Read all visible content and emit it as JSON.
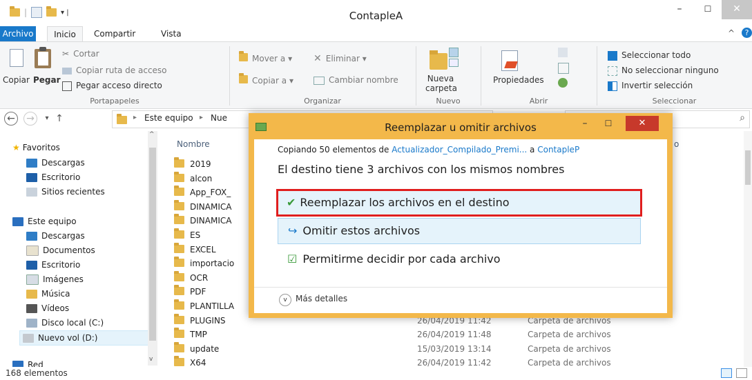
{
  "window": {
    "title": "ContapleA",
    "minimize": "–",
    "maximize": "☐",
    "close": "✕"
  },
  "ribbon": {
    "tabs": [
      "Archivo",
      "Inicio",
      "Compartir",
      "Vista"
    ],
    "portapapeles": {
      "copy": "Copiar",
      "paste": "Pegar",
      "cut": "Cortar",
      "copy_path": "Copiar ruta de acceso",
      "paste_shortcut": "Pegar acceso directo",
      "label": "Portapapeles"
    },
    "organizar": {
      "move_to": "Mover a ▾",
      "copy_to": "Copiar a ▾",
      "delete": "Eliminar ▾",
      "rename": "Cambiar nombre",
      "label": "Organizar"
    },
    "nuevo": {
      "new_folder_1": "Nueva",
      "new_folder_2": "carpeta",
      "label": "Nuevo"
    },
    "abrir": {
      "properties": "Propiedades",
      "label": "Abrir"
    },
    "seleccionar": {
      "select_all": "Seleccionar todo",
      "select_none": "No seleccionar ninguno",
      "invert": "Invertir selección",
      "label": "Seleccionar"
    }
  },
  "address": {
    "back": "←",
    "forward": "→",
    "recent": "▾",
    "up": "↑",
    "path_1": "Este equipo",
    "path_2": "Nue",
    "search_icon": "⌕"
  },
  "nav": {
    "favorites": "Favoritos",
    "fav_items": [
      "Descargas",
      "Escritorio",
      "Sitios recientes"
    ],
    "this_pc": "Este equipo",
    "pc_items": [
      "Descargas",
      "Documentos",
      "Escritorio",
      "Imágenes",
      "Música",
      "Vídeos",
      "Disco local (C:)",
      "Nuevo vol (D:)"
    ],
    "network": "Red"
  },
  "list": {
    "col_name": "Nombre",
    "col_type_partial": "o",
    "files": [
      {
        "name": "2019",
        "date": "",
        "type": ""
      },
      {
        "name": "alcon",
        "date": "",
        "type": ""
      },
      {
        "name": "App_FOX_",
        "date": "",
        "type": ""
      },
      {
        "name": "DINAMICA",
        "date": "",
        "type": ""
      },
      {
        "name": "DINAMICA",
        "date": "",
        "type": ""
      },
      {
        "name": "ES",
        "date": "",
        "type": ""
      },
      {
        "name": "EXCEL",
        "date": "",
        "type": ""
      },
      {
        "name": "importacio",
        "date": "",
        "type": ""
      },
      {
        "name": "OCR",
        "date": "",
        "type": ""
      },
      {
        "name": "PDF",
        "date": "",
        "type": ""
      },
      {
        "name": "PLANTILLA",
        "date": "",
        "type": ""
      },
      {
        "name": "PLUGINS",
        "date": "26/04/2019 11:42",
        "type": "Carpeta de archivos"
      },
      {
        "name": "TMP",
        "date": "26/04/2019 11:48",
        "type": "Carpeta de archivos"
      },
      {
        "name": "update",
        "date": "15/03/2019 13:14",
        "type": "Carpeta de archivos"
      },
      {
        "name": "X64",
        "date": "26/04/2019 11:42",
        "type": "Carpeta de archivos"
      }
    ]
  },
  "status": {
    "count": "168 elementos"
  },
  "dialog": {
    "title": "Reemplazar u omitir archivos",
    "copy_prefix": "Copiando 50 elementos de ",
    "source": "Actualizador_Compilado_Premi...",
    "middle": " a ",
    "dest": "ContapleP",
    "heading": "El destino tiene 3 archivos con los mismos nombres",
    "opt_replace": "Reemplazar los archivos en el destino",
    "opt_skip": "Omitir estos archivos",
    "opt_decide": "Permitirme decidir por cada archivo",
    "more_details": "Más detalles",
    "minimize": "–",
    "maximize": "☐",
    "close": "✕"
  },
  "colors": {
    "accent": "#1979ca",
    "dialog_frame": "#f3b84a",
    "close_red": "#c7392b",
    "highlight": "#e5f3fb",
    "selected_border": "#e01e1e"
  }
}
